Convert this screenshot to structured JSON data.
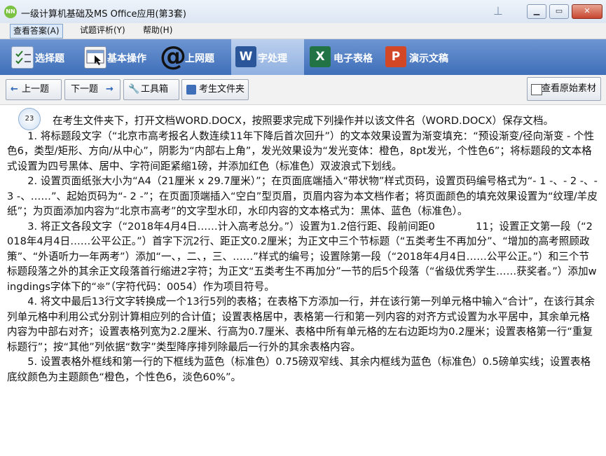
{
  "window": {
    "title": "一级计算机基础及MS Office应用(第3套)",
    "app_icon": "app-logo-icon"
  },
  "menu": [
    {
      "label": "查看答案(A)",
      "active": true
    },
    {
      "label": "试题评析(Y)",
      "active": false
    },
    {
      "label": "帮助(H)",
      "active": false
    }
  ],
  "categories": [
    {
      "label": "选择题",
      "icon": "checklist-icon",
      "active": false
    },
    {
      "label": "基本操作",
      "icon": "window-cursor-icon",
      "active": false
    },
    {
      "label": "上网题",
      "icon": "at-sign-icon",
      "active": false
    },
    {
      "label": "字处理",
      "icon": "word-icon",
      "active": true
    },
    {
      "label": "电子表格",
      "icon": "excel-icon",
      "active": false
    },
    {
      "label": "演示文稿",
      "icon": "powerpoint-icon",
      "active": false
    }
  ],
  "toolbar": {
    "prev": "上一题",
    "next": "下一题",
    "tools": "工具箱",
    "folder": "考生文件夹",
    "view_source": "查看原始素材"
  },
  "question": {
    "number": "23",
    "paragraphs": [
      "在考生文件夹下，打开文档WORD.DOCX，按照要求完成下列操作并以该文件名（WORD.DOCX）保存文档。",
      "1. 将标题段文字（“北京市高考报名人数连续11年下降后首次回升”）的文本效果设置为渐变填充：“预设渐变/径向渐变 - 个性色6，类型/矩形、方向/从中心”，阴影为“内部右上角”，发光效果设为“发光变体：橙色，8pt发光，个性色6”；将标题段的文本格式设置为四号黑体、居中、字符间距紧缩1磅，并添加红色（标准色）双波浪式下划线。",
      "2. 设置页面纸张大小为“A4（21厘米 x 29.7厘米）”；在页面底端插入“带状物”样式页码，设置页码编号格式为“- 1 -、- 2 -、- 3 -、……”、起始页码为“- 2 -”；在页面顶端插入“空白”型页眉，页眉内容为本文档作者；将页面颜色的填充效果设置为“纹理/羊皮纸”；为页面添加内容为“北京市高考”的文字型水印，水印内容的文本格式为：黑体、蓝色（标准色）。",
      "3. 将正文各段文字（“2018年4月4日……计入高考总分。”）设置为1.2倍行距、段前间距0　　　　11；设置正文第一段（“2018年4月4日……公平公正。”）首字下沉2行、距正文0.2厘米；为正文中三个节标题（“五类考生不再加分”、“增加的高考照顾政策”、“外语听力一年两考”）添加“一、，二、，三、……”样式的编号；设置除第一段（“2018年4月4日……公平公正。”）和三个节标题段落之外的其余正文段落首行缩进2字符；为正文“五类考生不再加分”一节的后5个段落（“省级优秀学生……获奖者。”）添加wingdings字体下的“❊”（字符代码：0054）作为项目符号。",
      "4. 将文中最后13行文字转换成一个13行5列的表格；在表格下方添加一行，并在该行第一列单元格中输入“合计”，在该行其余列单元格中利用公式分别计算相应列的合计值；设置表格居中，表格第一行和第一列内容的对齐方式设置为水平居中，其余单元格内容为中部右对齐；设置表格列宽为2.2厘米、行高为0.7厘米、表格中所有单元格的左右边距均为0.2厘米；设置表格第一行“重复标题行”；按“其他”列依据“数字”类型降序排列除最后一行外的其余表格内容。",
      "5. 设置表格外框线和第一行的下框线为蓝色（标准色）0.75磅双窄线、其余内框线为蓝色（标准色）0.5磅单实线；设置表格底纹颜色为主题颜色“橙色，个性色6，淡色60%”。"
    ]
  }
}
